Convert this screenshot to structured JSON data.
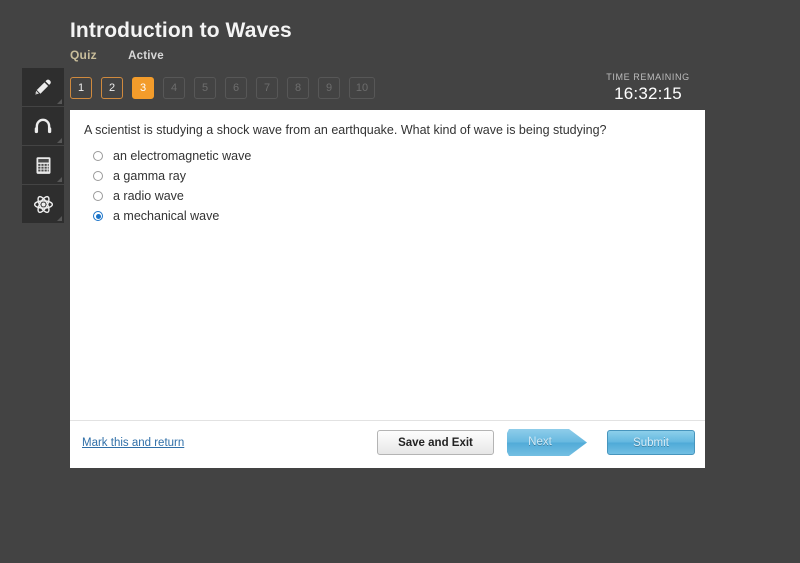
{
  "header": {
    "title": "Introduction to Waves",
    "kind": "Quiz",
    "state": "Active"
  },
  "timer": {
    "label": "TIME REMAINING",
    "value": "16:32:15"
  },
  "question_nav": {
    "items": [
      {
        "number": "1",
        "status": "visited"
      },
      {
        "number": "2",
        "status": "visited"
      },
      {
        "number": "3",
        "status": "current"
      },
      {
        "number": "4",
        "status": "inactive"
      },
      {
        "number": "5",
        "status": "inactive"
      },
      {
        "number": "6",
        "status": "inactive"
      },
      {
        "number": "7",
        "status": "inactive"
      },
      {
        "number": "8",
        "status": "inactive"
      },
      {
        "number": "9",
        "status": "inactive"
      },
      {
        "number": "10",
        "status": "inactive"
      }
    ]
  },
  "tools": [
    {
      "icon": "pencil-icon"
    },
    {
      "icon": "headphones-icon"
    },
    {
      "icon": "calculator-icon"
    },
    {
      "icon": "atom-icon"
    }
  ],
  "question": {
    "text": "A scientist is studying a shock wave from an earthquake. What kind of wave is being studying?",
    "options": [
      {
        "label": "an electromagnetic wave",
        "selected": false
      },
      {
        "label": "a gamma ray",
        "selected": false
      },
      {
        "label": "a radio wave",
        "selected": false
      },
      {
        "label": "a mechanical wave",
        "selected": true
      }
    ]
  },
  "footer": {
    "mark_link": "Mark this and return",
    "save_label": "Save and Exit",
    "next_label": "Next",
    "submit_label": "Submit"
  },
  "colors": {
    "page_background": "#434343",
    "accent_orange": "#f39c2b",
    "accent_blue": "#64b8e0",
    "radio_blue": "#1a73c8",
    "link_blue": "#2f6fa8",
    "kind_tan": "#c8bd9a"
  }
}
